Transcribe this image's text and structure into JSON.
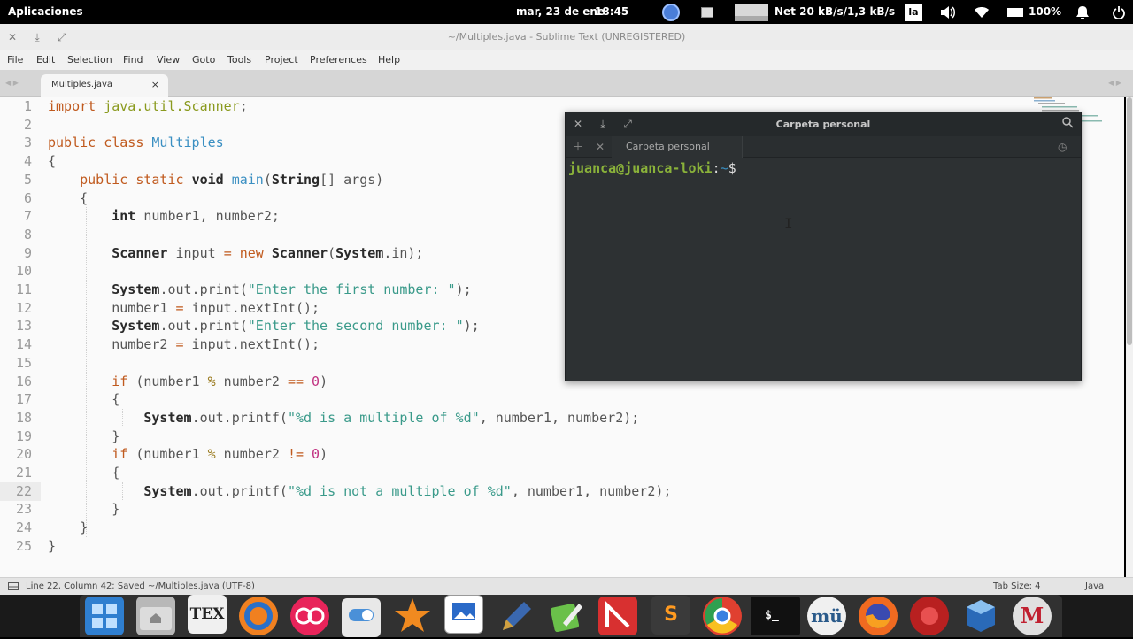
{
  "topbar": {
    "activities": "Aplicaciones",
    "datetime_date": "mar, 23 de ene",
    "datetime_time": "18:45",
    "net": "Net 20 kB/s/1,3 kB/s",
    "keyboard": "la",
    "battery": "100%"
  },
  "window": {
    "title": "~/Multiples.java - Sublime Text (UNREGISTERED)"
  },
  "menu": {
    "items": [
      "File",
      "Edit",
      "Selection",
      "Find",
      "View",
      "Goto",
      "Tools",
      "Project",
      "Preferences",
      "Help"
    ]
  },
  "tab": {
    "label": "Multiples.java",
    "close": "×"
  },
  "code": {
    "line_numbers": [
      "1",
      "2",
      "3",
      "4",
      "5",
      "6",
      "7",
      "8",
      "9",
      "10",
      "11",
      "12",
      "13",
      "14",
      "15",
      "16",
      "17",
      "18",
      "19",
      "20",
      "21",
      "22",
      "23",
      "24",
      "25"
    ],
    "l1_kw": "import",
    "l1_pkg": "java.util.Scanner",
    "l1_end": ";",
    "l3_kw": "public class",
    "l3_cls": "Multiples",
    "l4": "{",
    "l5_kw": "public static",
    "l5_void": "void",
    "l5_fn": "main",
    "l5_p1": "(",
    "l5_type": "String",
    "l5_rest": "[] args)",
    "l6": "{",
    "l7_type": "int",
    "l7_rest": " number1, number2;",
    "l9_type": "Scanner",
    "l9_var": " input ",
    "l9_eq": "=",
    "l9_new": " new ",
    "l9_type2": "Scanner",
    "l9_p": "(",
    "l9_sys": "System",
    "l9_rest": ".in);",
    "l11_sys": "System",
    "l11_out": ".out.",
    "l11_fn": "print(",
    "l11_str": "\"Enter the first number: \"",
    "l11_end": ");",
    "l12_a": "number1 ",
    "l12_eq": "=",
    "l12_b": " input",
    "l12_c": ".nextInt();",
    "l13_sys": "System",
    "l13_out": ".out.",
    "l13_fn": "print(",
    "l13_str": "\"Enter the second number: \"",
    "l13_end": ");",
    "l14_a": "number2 ",
    "l14_eq": "=",
    "l14_b": " input",
    "l14_c": ".nextInt();",
    "l16_if": "if",
    "l16_a": " (number1 ",
    "l16_mod": "%",
    "l16_b": " number2 ",
    "l16_op": "==",
    "l16_sp": " ",
    "l16_num": "0",
    "l16_end": ")",
    "l17": "{",
    "l18_sys": "System",
    "l18_out": ".out.",
    "l18_fn": "printf(",
    "l18_str": "\"%d is a multiple of %d\"",
    "l18_end": ", number1, number2);",
    "l19": "}",
    "l20_if": "if",
    "l20_a": " (number1 ",
    "l20_mod": "%",
    "l20_b": " number2 ",
    "l20_op": "!=",
    "l20_sp": " ",
    "l20_num": "0",
    "l20_end": ")",
    "l21": "{",
    "l22_sys": "System",
    "l22_out": ".out.",
    "l22_fn": "printf(",
    "l22_str": "\"%d is not a multiple of %d\"",
    "l22_end": ", number1, number2);",
    "l23": "}",
    "l24": "}",
    "l25": "}"
  },
  "status": {
    "position": "Line 22, Column 42; Saved ~/Multiples.java (UTF-8)",
    "tab_size": "Tab Size: 4",
    "syntax": "Java"
  },
  "terminal": {
    "title": "Carpeta personal",
    "tab_label": "Carpeta personal",
    "prompt_user": "juanca@juanca-loki",
    "prompt_colon": ":",
    "prompt_path": "~",
    "prompt_symbol": "$"
  },
  "dock": {
    "icons": [
      "files-icon",
      "home-folder-icon",
      "texmaker-icon",
      "ubuntu-software-icon",
      "flickr-icon",
      "settings-icon",
      "inkscape-icon",
      "writer-icon",
      "pen-icon",
      "edit-icon",
      "git-icon",
      "sublime-text-icon",
      "chrome-icon",
      "terminal-icon",
      "musescore-icon",
      "firefox-icon",
      "redshift-icon",
      "virtualbox-icon",
      "maxima-icon"
    ],
    "tex_label": "TEX",
    "sublime_label": "S",
    "terminal_label": "$_",
    "mu_label": "mü",
    "m_label": "M"
  },
  "colors": {
    "editor_bg": "#fafafa",
    "terminal_bg": "#2d3133",
    "prompt_user": "#8ab23a",
    "prompt_path": "#3a8fc2"
  }
}
